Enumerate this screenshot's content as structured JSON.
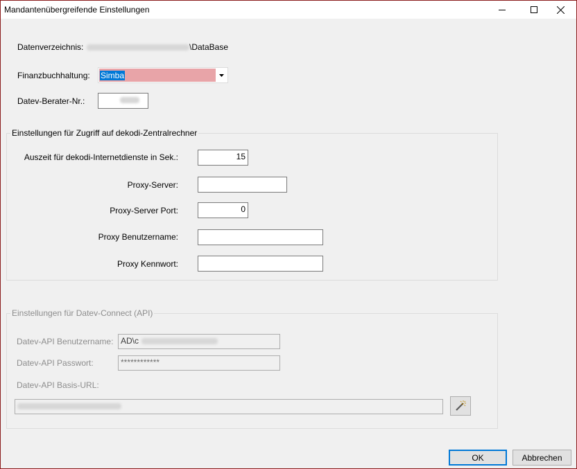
{
  "window": {
    "title": "Mandantenübergreifende Einstellungen"
  },
  "general": {
    "datenverzeichnis_label": "Datenverzeichnis:",
    "datenverzeichnis_value_suffix": "\\DataBase",
    "finanzbuchhaltung_label": "Finanzbuchhaltung:",
    "finanzbuchhaltung_value": "Simba",
    "berater_label": "Datev-Berater-Nr.:"
  },
  "zentralrechner": {
    "title": "Einstellungen für Zugriff auf dekodi-Zentralrechner",
    "timeout_label": "Auszeit für dekodi-Internetdienste in Sek.:",
    "timeout_value": "15",
    "proxy_server_label": "Proxy-Server:",
    "proxy_server_value": "",
    "proxy_port_label": "Proxy-Server Port:",
    "proxy_port_value": "0",
    "proxy_user_label": "Proxy Benutzername:",
    "proxy_user_value": "",
    "proxy_pass_label": "Proxy Kennwort:",
    "proxy_pass_value": ""
  },
  "datev_connect": {
    "title": "Einstellungen für Datev-Connect (API)",
    "user_label": "Datev-API Benutzername:",
    "user_value_prefix": "AD\\c",
    "pass_label": "Datev-API Passwort:",
    "pass_value": "************",
    "url_label": "Datev-API Basis-URL:"
  },
  "buttons": {
    "ok": "OK",
    "cancel": "Abbrechen"
  },
  "icons": {
    "minimize": "minimize-icon",
    "maximize": "maximize-icon",
    "close": "close-icon",
    "dropdown": "chevron-down-icon",
    "wand": "magic-wand-icon"
  }
}
